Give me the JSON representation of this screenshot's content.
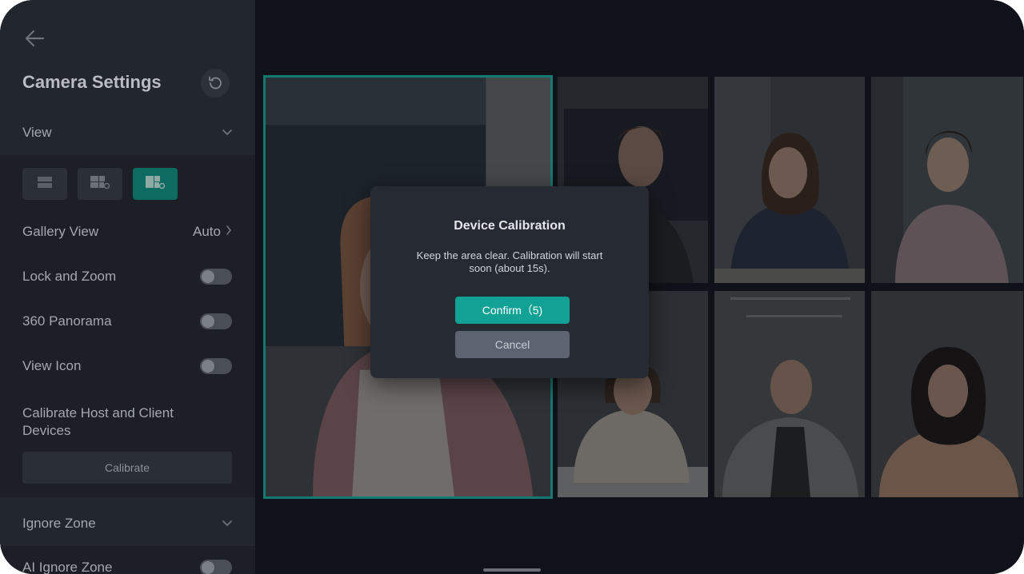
{
  "sidebar": {
    "title": "Camera Settings",
    "view_section": "View",
    "gallery_view_label": "Gallery View",
    "gallery_view_value": "Auto",
    "lock_zoom_label": "Lock and Zoom",
    "lock_zoom_on": false,
    "panorama_label": "360 Panorama",
    "panorama_on": false,
    "view_icon_label": "View Icon",
    "view_icon_on": false,
    "calibrate_label": "Calibrate Host and Client Devices",
    "calibrate_button": "Calibrate",
    "ignore_zone_section": "Ignore Zone",
    "ai_ignore_zone_label": "AI Ignore Zone",
    "ai_ignore_zone_on": false,
    "selected_layout": "layout-3",
    "icons": [
      "back-arrow-icon",
      "reset-icon",
      "chevron-down-icon",
      "chevron-right-icon",
      "layout-speaker-icon",
      "layout-grid-icon",
      "layout-mixed-icon"
    ]
  },
  "dialog": {
    "title": "Device Calibration",
    "message": "Keep the area clear. Calibration will start soon (about 15s).",
    "confirm_label": "Confirm（5)",
    "cancel_label": "Cancel"
  },
  "colors": {
    "accent": "#12a195",
    "selected_layout_bg": "#0d6b62",
    "active_tile_border": "#127a70",
    "dialog_bg": "#252a33",
    "sidebar_bg": "#22262d"
  }
}
